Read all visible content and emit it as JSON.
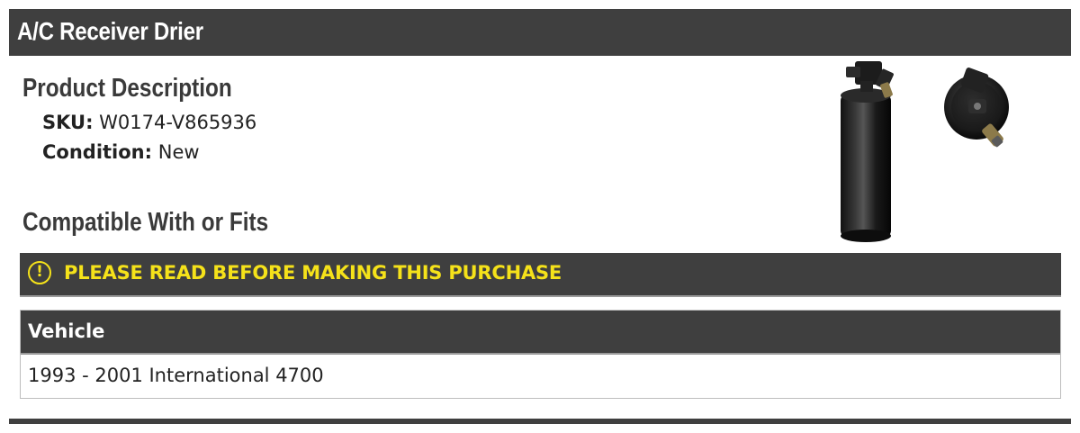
{
  "header": {
    "title": "A/C Receiver Drier"
  },
  "description": {
    "heading": "Product Description",
    "sku_label": "SKU:",
    "sku_value": "W0174-V865936",
    "condition_label": "Condition:",
    "condition_value": "New"
  },
  "compat": {
    "heading": "Compatible With or Fits"
  },
  "warning": {
    "icon": "exclamation-circle-icon",
    "icon_glyph": "!",
    "text": "PLEASE READ BEFORE MAKING THIS PURCHASE",
    "color": "#f5e21a"
  },
  "vehicle_table": {
    "header": "Vehicle",
    "rows": [
      "1993 - 2001 International 4700"
    ]
  },
  "colors": {
    "bar": "#3f3f3f",
    "accent": "#f5e21a"
  }
}
